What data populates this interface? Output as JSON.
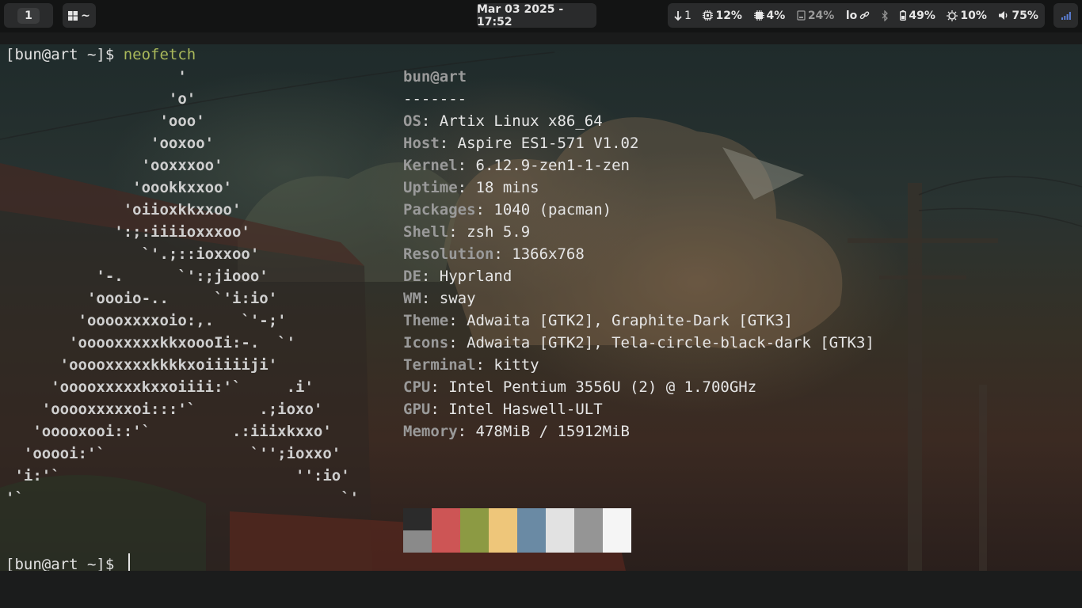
{
  "topbar": {
    "workspace": "1",
    "launcher_label": "~",
    "clock": "Mar 03 2025 - 17:52",
    "status": {
      "updates": "1",
      "cpu": "12%",
      "ram": "4%",
      "disk": "24%",
      "network": "lo",
      "battery": "49%",
      "brightness": "10%",
      "volume": "75%"
    }
  },
  "terminal": {
    "prompt1": "[bun@art ~]$ ",
    "command": "neofetch",
    "prompt2": "[bun@art ~]$ ",
    "logo_lines": [
      "                   '",
      "                  'o'",
      "                 'ooo'",
      "                'ooxoo'",
      "               'ooxxxoo'",
      "              'oookkxxoo'",
      "             'oiioxkkxxoo'",
      "            ':;:iiiioxxxoo'",
      "               `'.;::ioxxoo'",
      "          '-.      `':;jiooo'",
      "         'oooio-..     `'i:io'",
      "        'ooooxxxxoio:,.   `'-;'",
      "       'ooooxxxxxkkxoooIi:-.  `'",
      "      'ooooxxxxxkkkkxoiiiiiji'",
      "     'ooooxxxxxkxxoiiii:'`     .i'",
      "    'ooooxxxxxoi:::'`       .;ioxo'",
      "   'ooooxooi::'`         .:iiixkxxo'",
      "  'ooooi:'`                `'';ioxxo'",
      " 'i:'`                          '':io'",
      "'`                                   `'"
    ],
    "user_host": "bun@art",
    "separator": "-------",
    "info": [
      {
        "key": "OS",
        "value": "Artix Linux x86_64"
      },
      {
        "key": "Host",
        "value": "Aspire ES1-571 V1.02"
      },
      {
        "key": "Kernel",
        "value": "6.12.9-zen1-1-zen"
      },
      {
        "key": "Uptime",
        "value": "18 mins"
      },
      {
        "key": "Packages",
        "value": "1040 (pacman)"
      },
      {
        "key": "Shell",
        "value": "zsh 5.9"
      },
      {
        "key": "Resolution",
        "value": "1366x768"
      },
      {
        "key": "DE",
        "value": "Hyprland"
      },
      {
        "key": "WM",
        "value": "sway"
      },
      {
        "key": "Theme",
        "value": "Adwaita [GTK2], Graphite-Dark [GTK3]"
      },
      {
        "key": "Icons",
        "value": "Adwaita [GTK2], Tela-circle-black-dark [GTK3]"
      },
      {
        "key": "Terminal",
        "value": "kitty"
      },
      {
        "key": "CPU",
        "value": "Intel Pentium 3556U (2) @ 1.700GHz"
      },
      {
        "key": "GPU",
        "value": "Intel Haswell-ULT"
      },
      {
        "key": "Memory",
        "value": "478MiB / 15912MiB"
      }
    ],
    "palette": {
      "top": [
        "#2b2b2b",
        "#cd5555",
        "#8c9a43",
        "#eec67a",
        "#6a8aa4",
        "#e2e2e2",
        "#959595",
        "#f5f5f5"
      ],
      "bottom": [
        "#8a8a8a",
        "#cd5555",
        "#8c9a43",
        "#eec67a",
        "#6a8aa4",
        "#e2e2e2",
        "#959595",
        "#f5f5f5"
      ]
    }
  },
  "colors": {
    "bar_bg": "#131414",
    "pill_bg": "#2a2b2c",
    "prompt_command": "#a9b85a"
  }
}
